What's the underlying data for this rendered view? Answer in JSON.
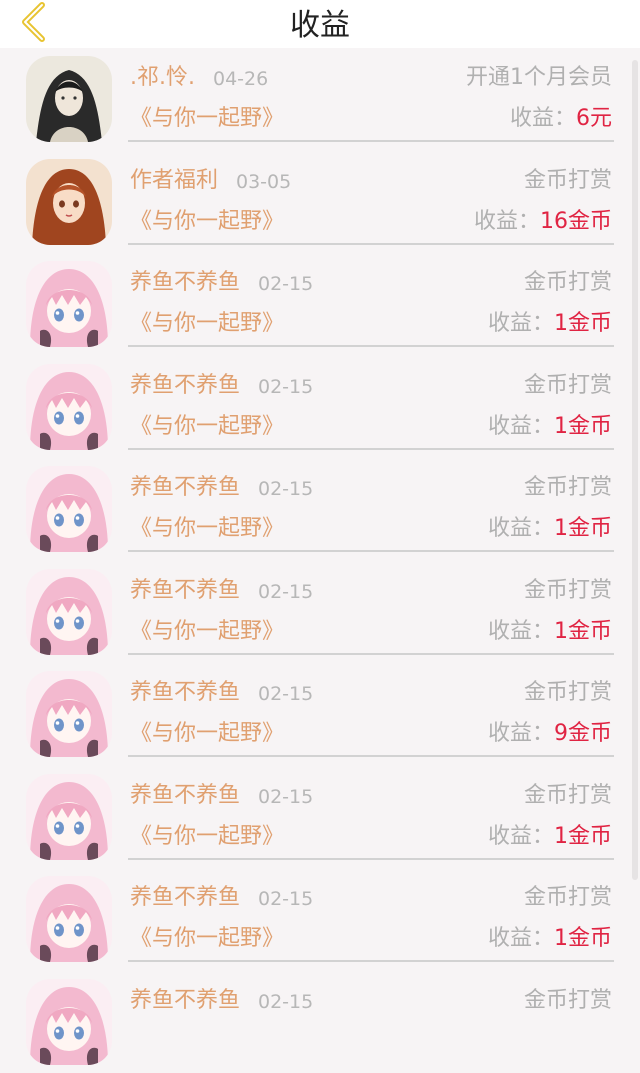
{
  "header": {
    "title": "收益"
  },
  "earn_label": "收益：",
  "colors": {
    "name": "#e0a070",
    "value": "#e02443",
    "muted": "#b0b0b0",
    "background": "#f7f4f5"
  },
  "rows": [
    {
      "name": ".祁.怜.",
      "date": "04-26",
      "type": "开通1个月会员",
      "book": "《与你一起野》",
      "value": "6元",
      "avatar": "ink-portrait"
    },
    {
      "name": "作者福利",
      "date": "03-05",
      "type": "金币打赏",
      "book": "《与你一起野》",
      "value": "16金币",
      "avatar": "redhair-girl"
    },
    {
      "name": "养鱼不养鱼",
      "date": "02-15",
      "type": "金币打赏",
      "book": "《与你一起野》",
      "value": "1金币",
      "avatar": "pink-girl"
    },
    {
      "name": "养鱼不养鱼",
      "date": "02-15",
      "type": "金币打赏",
      "book": "《与你一起野》",
      "value": "1金币",
      "avatar": "pink-girl"
    },
    {
      "name": "养鱼不养鱼",
      "date": "02-15",
      "type": "金币打赏",
      "book": "《与你一起野》",
      "value": "1金币",
      "avatar": "pink-girl"
    },
    {
      "name": "养鱼不养鱼",
      "date": "02-15",
      "type": "金币打赏",
      "book": "《与你一起野》",
      "value": "1金币",
      "avatar": "pink-girl"
    },
    {
      "name": "养鱼不养鱼",
      "date": "02-15",
      "type": "金币打赏",
      "book": "《与你一起野》",
      "value": "9金币",
      "avatar": "pink-girl"
    },
    {
      "name": "养鱼不养鱼",
      "date": "02-15",
      "type": "金币打赏",
      "book": "《与你一起野》",
      "value": "1金币",
      "avatar": "pink-girl"
    },
    {
      "name": "养鱼不养鱼",
      "date": "02-15",
      "type": "金币打赏",
      "book": "《与你一起野》",
      "value": "1金币",
      "avatar": "pink-girl"
    },
    {
      "name": "养鱼不养鱼",
      "date": "02-15",
      "type": "金币打赏",
      "book": "",
      "value": "",
      "avatar": "pink-girl"
    }
  ]
}
